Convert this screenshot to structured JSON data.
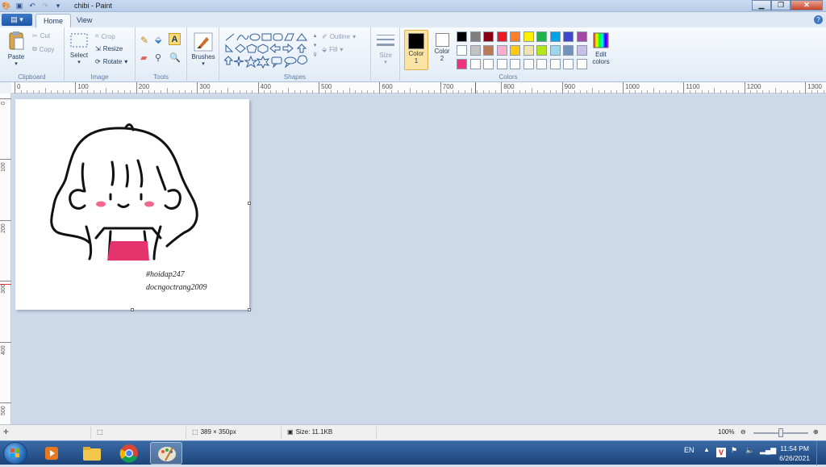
{
  "window": {
    "title": "chibi - Paint"
  },
  "tabs": {
    "file": "▤ ▾",
    "home": "Home",
    "view": "View"
  },
  "clipboard": {
    "paste": "Paste",
    "cut": "Cut",
    "copy": "Copy",
    "group": "Clipboard"
  },
  "image": {
    "select": "Select",
    "crop": "Crop",
    "resize": "Resize",
    "rotate": "Rotate",
    "group": "Image"
  },
  "tools": {
    "group": "Tools"
  },
  "brushes": {
    "label": "Brushes"
  },
  "shapes": {
    "outline": "Outline",
    "fill": "Fill",
    "group": "Shapes"
  },
  "size": {
    "label": "Size"
  },
  "colors": {
    "color1": "Color",
    "color1_num": "1",
    "color2": "Color",
    "color2_num": "2",
    "edit": "Edit",
    "edit2": "colors",
    "group": "Colors",
    "palette_row1": [
      "#000000",
      "#7f7f7f",
      "#880015",
      "#ed1c24",
      "#ff7f27",
      "#fff200",
      "#22b14c",
      "#00a2e8",
      "#3f48cc",
      "#a349a4"
    ],
    "palette_row2": [
      "#ffffff",
      "#c3c3c3",
      "#b97a57",
      "#ffaec9",
      "#ffc90e",
      "#efe4b0",
      "#b5e61d",
      "#99d9ea",
      "#7092be",
      "#c8bfe7"
    ],
    "palette_row3": [
      "#ee3377",
      "#ffffff",
      "#ffffff",
      "#ffffff",
      "#ffffff",
      "#ffffff",
      "#ffffff",
      "#ffffff",
      "#ffffff",
      "#ffffff"
    ]
  },
  "ruler": {
    "h_ticks": [
      "0",
      "100",
      "200",
      "300",
      "400",
      "500",
      "600",
      "700",
      "800",
      "900",
      "1000",
      "1100",
      "1200",
      "1300"
    ],
    "v_ticks": [
      "0",
      "100",
      "200",
      "300",
      "400",
      "500"
    ]
  },
  "canvas": {
    "watermark1": "#hoidap247",
    "watermark2": "docngoctrang2009"
  },
  "status": {
    "dimensions": "389 × 350px",
    "size": "Size: 11.1KB",
    "zoom": "100%"
  },
  "taskbar": {
    "lang": "EN",
    "time": "11:54 PM",
    "date": "6/26/2021"
  }
}
